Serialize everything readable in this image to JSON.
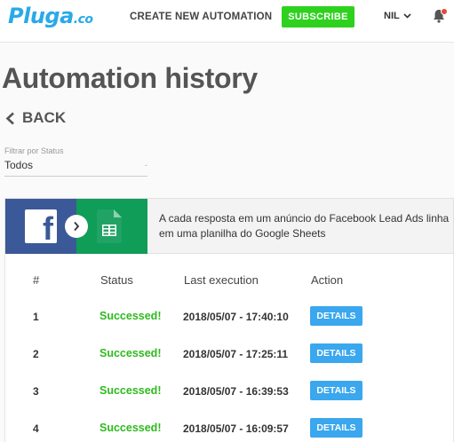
{
  "header": {
    "logo_main": "Pluga",
    "logo_suffix": ".co",
    "create_label": "CREATE NEW AUTOMATION",
    "subscribe_label": "SUBSCRIBE",
    "user_label": "NIL",
    "accent_color": "#29a9e9",
    "subscribe_color": "#2fd11f"
  },
  "page": {
    "title": "Automation history",
    "back_label": "BACK"
  },
  "filter": {
    "label": "Filtrar por Status",
    "value": "Todos"
  },
  "automation": {
    "source_app": "facebook-icon",
    "target_app": "google-sheets-icon",
    "description": "A cada resposta em um anúncio do Facebook Lead Ads linha em uma planilha do Google Sheets"
  },
  "table": {
    "columns": [
      "#",
      "Status",
      "Last execution",
      "Action"
    ],
    "rows": [
      {
        "num": "1",
        "status": "Successed!",
        "date": "2018/05/07 - 17:40:10",
        "action": "DETAILS"
      },
      {
        "num": "2",
        "status": "Successed!",
        "date": "2018/05/07 - 17:25:11",
        "action": "DETAILS"
      },
      {
        "num": "3",
        "status": "Successed!",
        "date": "2018/05/07 - 16:39:53",
        "action": "DETAILS"
      },
      {
        "num": "4",
        "status": "Successed!",
        "date": "2018/05/07 - 16:09:57",
        "action": "DETAILS"
      }
    ],
    "status_color": "#2fba1f",
    "action_color": "#3aa7ee"
  }
}
